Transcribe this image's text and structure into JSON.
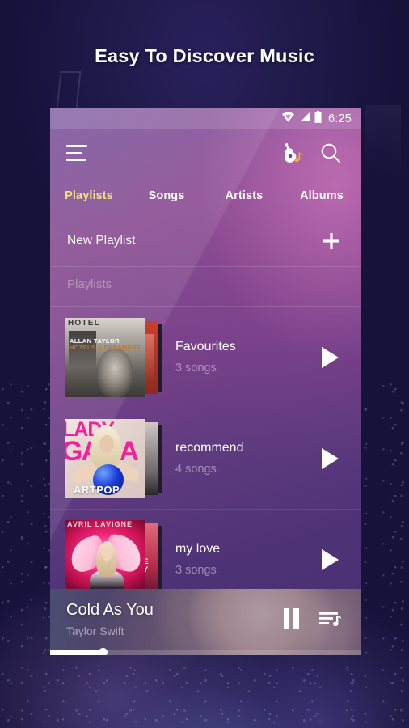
{
  "promo": {
    "headline": "Easy To Discover Music"
  },
  "status_bar": {
    "time": "6:25",
    "icons": [
      "wifi-icon",
      "cellular-signal-icon",
      "battery-icon"
    ]
  },
  "toolbar": {
    "menu_icon": "hamburger-menu-icon",
    "guitar_icon": "guitar-music-icon",
    "search_icon": "search-icon"
  },
  "tabs": [
    {
      "label": "Playlists",
      "active": true
    },
    {
      "label": "Songs",
      "active": false
    },
    {
      "label": "Artists",
      "active": false
    },
    {
      "label": "Albums",
      "active": false
    }
  ],
  "new_playlist": {
    "label": "New Playlist",
    "add_icon": "plus-icon"
  },
  "section": {
    "header": "Playlists"
  },
  "playlists": [
    {
      "title": "Favourites",
      "count": "3 songs",
      "play_icon": "play-icon",
      "cover": {
        "artist": "ALLAN TAYLOR",
        "album": "HOTELS & DREAMERS",
        "sign": "HOTEL"
      }
    },
    {
      "title": "recommend",
      "count": "4 songs",
      "play_icon": "play-icon",
      "cover": {
        "artist_line1": "LADY",
        "artist_line2": "GAGA",
        "album": "ARTPOP"
      }
    },
    {
      "title": "my love",
      "count": "3 songs",
      "play_icon": "play-icon",
      "cover": {
        "artist": "AVRIL LAVIGNE"
      }
    }
  ],
  "now_playing": {
    "title": "Cold As You",
    "artist": "Taylor Swift",
    "pause_icon": "pause-icon",
    "queue_icon": "playlist-queue-icon",
    "progress_percent": 17
  },
  "colors": {
    "accent_tab": "#f2e37a",
    "screen_top": "#8a4f93",
    "screen_bottom": "#4a2f72",
    "promo_bg": "#191246",
    "text_primary": "#ffffff"
  }
}
